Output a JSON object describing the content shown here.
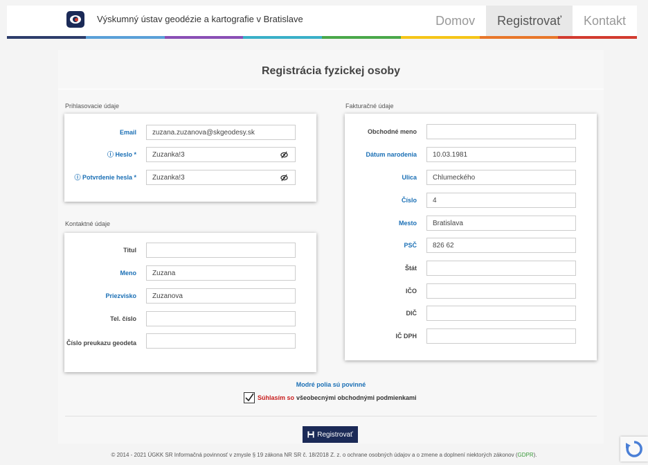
{
  "header": {
    "brand": "Výskumný ústav geodézie a kartografie v Bratislave",
    "nav": [
      "Domov",
      "Registrovať",
      "Kontakt"
    ],
    "active": "Registrovať",
    "stripe_colors": [
      "#2d3d6b",
      "#5aa0d8",
      "#8a4fb5",
      "#3ab0c8",
      "#4aa84a",
      "#f5c518",
      "#e8772a",
      "#d23b2f"
    ]
  },
  "page": {
    "title": "Registrácia fyzickej osoby"
  },
  "login": {
    "section": "Prihlasovacie údaje",
    "email_label": "Email",
    "email_value": "zuzana.zuzanova@skgeodesy.sk",
    "password_label": "ⓘ Heslo *",
    "password_value": "Zuzanka!3",
    "confirm_label": "ⓘ Potvrdenie hesla *",
    "confirm_value": "Zuzanka!3"
  },
  "contact": {
    "section": "Kontaktné údaje",
    "title_label": "Titul",
    "title_value": "",
    "first_label": "Meno",
    "first_value": "Zuzana",
    "last_label": "Priezvisko",
    "last_value": "Zuzanova",
    "phone_label": "Tel. číslo",
    "phone_value": "",
    "license_label": "Číslo preukazu geodeta",
    "license_value": ""
  },
  "billing": {
    "section": "Fakturačné údaje",
    "company_label": "Obchodné meno",
    "company_value": "",
    "dob_label": "Dátum narodenia",
    "dob_value": "10.03.1981",
    "street_label": "Ulica",
    "street_value": "Chlumeckého",
    "number_label": "Číslo",
    "number_value": "4",
    "city_label": "Mesto",
    "city_value": "Bratislava",
    "zip_label": "PSČ",
    "zip_value": "826 62",
    "country_label": "Štát",
    "country_value": "",
    "ico_label": "IČO",
    "ico_value": "",
    "dic_label": "DIČ",
    "dic_value": "",
    "icdph_label": "IČ DPH",
    "icdph_value": ""
  },
  "footer": {
    "required_note": "Modré polia sú povinné",
    "terms_red": "Súhlasím so",
    "terms_rest": "všeobecnými obchodnými podmienkami",
    "terms_checked": true,
    "submit": "Registrovať",
    "copyright": "© 2014 - 2021 ÚGKK SR Informačná povinnosť v zmysle § 19 zákona NR SR č. 18/2018 Z. z. o ochrane osobných údajov a o zmene a doplnení niektorých zákonov (",
    "gdpr": "GDPR",
    "copyright_end": ")."
  }
}
